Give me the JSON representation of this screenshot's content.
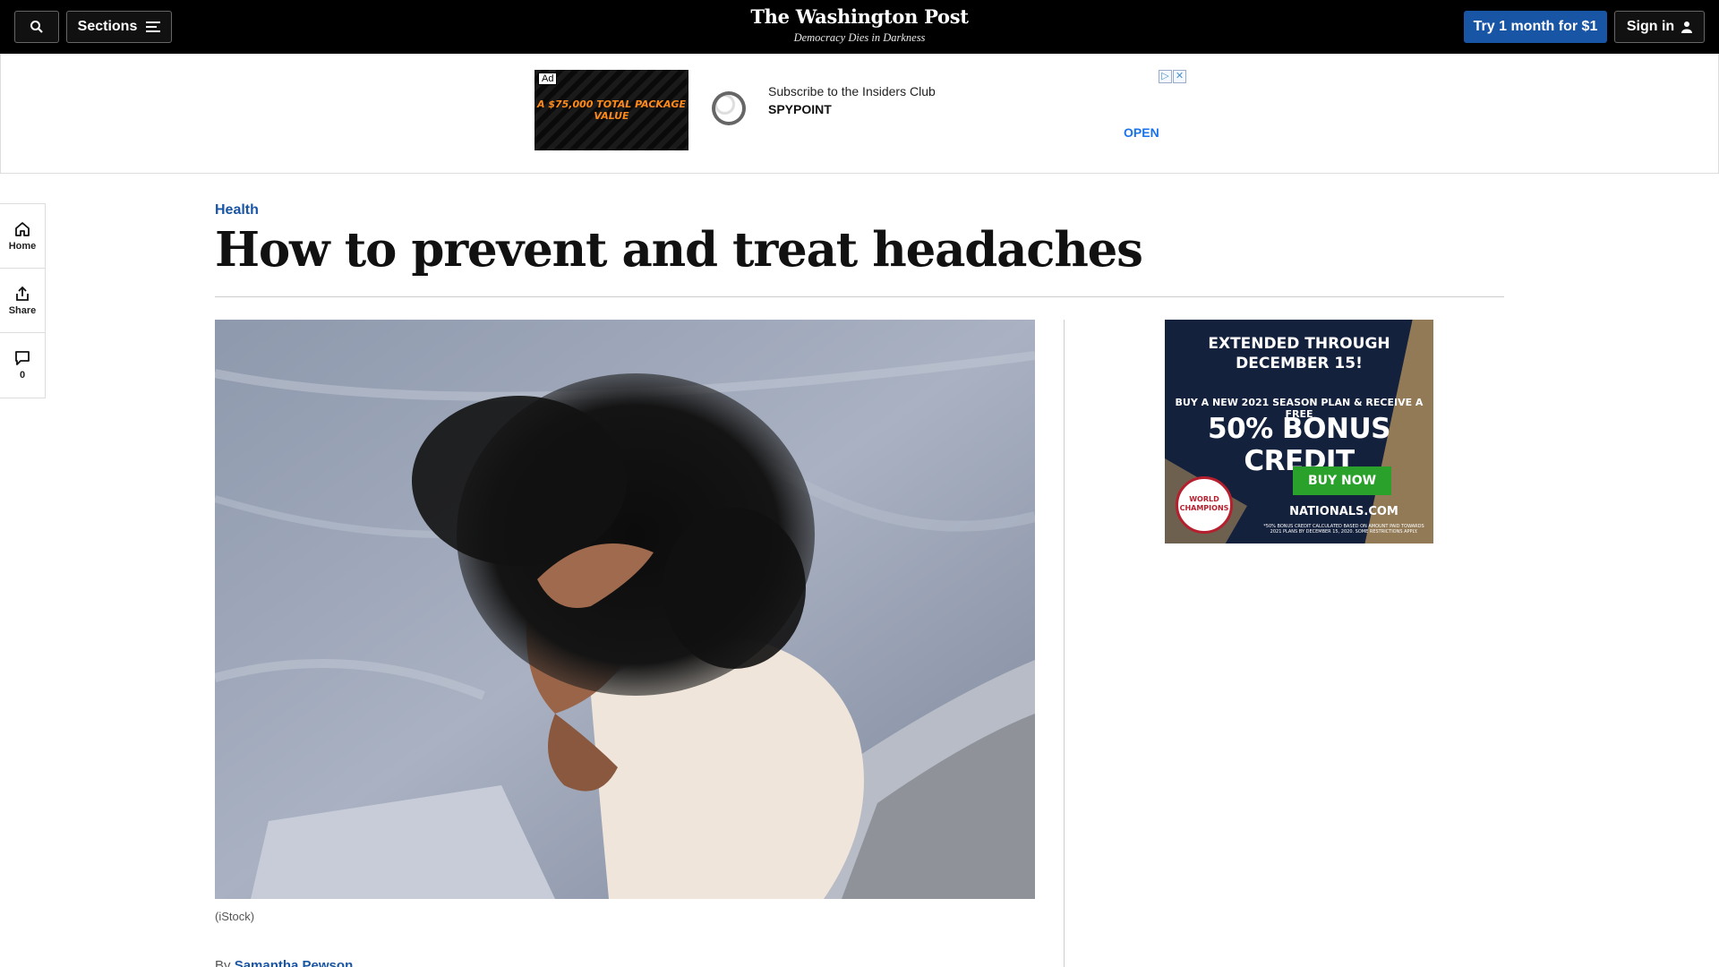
{
  "topbar": {
    "sections_label": "Sections",
    "logo": "The Washington Post",
    "tagline": "Democracy Dies in Darkness",
    "trial_label": "Try 1 month for $1",
    "signin_label": "Sign in"
  },
  "ad_banner": {
    "ad_label": "Ad",
    "image_text": "A $75,000 TOTAL PACKAGE VALUE",
    "title": "Subscribe to the Insiders Club",
    "advertiser": "SPYPOINT",
    "open_label": "OPEN"
  },
  "rail": {
    "home_label": "Home",
    "share_label": "Share",
    "comments_count": "0"
  },
  "article": {
    "kicker": "Health",
    "headline": "How to prevent and treat headaches",
    "caption": "(iStock)",
    "byline_prefix": "By",
    "byline_author": "Samantha Pewson"
  },
  "side_ad": {
    "top_text_1": "EXTENDED THROUGH",
    "top_text_2": "DECEMBER 15!",
    "mid_text": "BUY A NEW 2021 SEASON PLAN & RECEIVE A FREE",
    "big_text": "50% BONUS CREDIT",
    "buy_label": "BUY NOW",
    "site": "NATIONALS.COM",
    "fine_print": "*50% BONUS CREDIT CALCULATED BASED ON AMOUNT PAID TOWARDS 2021 PLANS BY DECEMBER 15, 2020. SOME RESTRICTIONS APPLY.",
    "badge_text": "WORLD CHAMPIONS"
  },
  "colors": {
    "brand_blue": "#1955a5",
    "topbar_bg": "#000000",
    "ad_open": "#1a73e8"
  }
}
